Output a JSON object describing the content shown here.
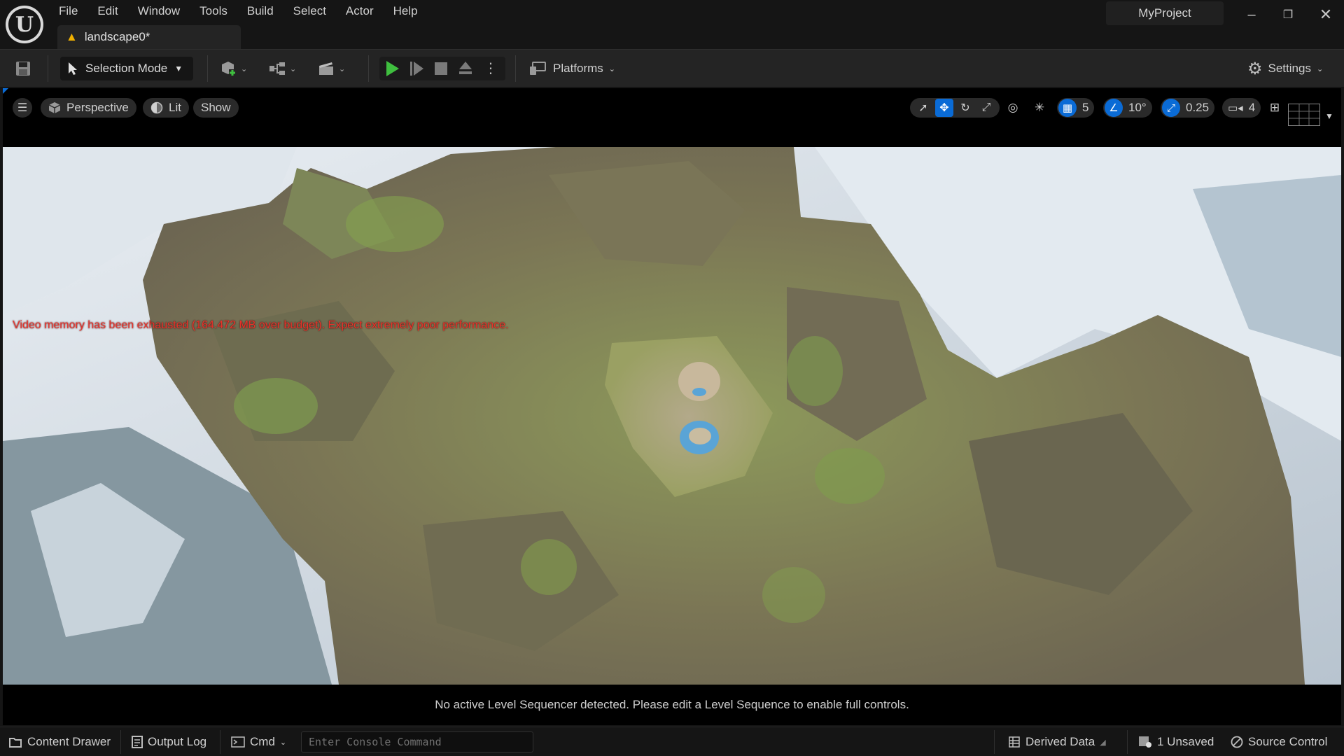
{
  "menu": {
    "items": [
      {
        "label": "File"
      },
      {
        "label": "Edit"
      },
      {
        "label": "Window"
      },
      {
        "label": "Tools"
      },
      {
        "label": "Build"
      },
      {
        "label": "Select"
      },
      {
        "label": "Actor"
      },
      {
        "label": "Help"
      }
    ]
  },
  "document_tab": {
    "label": "landscape0*"
  },
  "project": {
    "name": "MyProject"
  },
  "toolbar": {
    "mode_label": "Selection Mode",
    "platforms_label": "Platforms",
    "settings_label": "Settings"
  },
  "viewport": {
    "perspective_label": "Perspective",
    "lit_label": "Lit",
    "show_label": "Show",
    "grid_snap_value": "5",
    "rotation_snap_value": "10°",
    "scale_snap_value": "0.25",
    "camera_speed_value": "4",
    "warning_text": "Video memory has been exhausted (164.472 MB over budget). Expect extremely poor performance."
  },
  "sequencer": {
    "message": "No active Level Sequencer detected. Please edit a Level Sequence to enable full controls."
  },
  "statusbar": {
    "content_drawer_label": "Content Drawer",
    "output_log_label": "Output Log",
    "cmd_label": "Cmd",
    "console_placeholder": "Enter Console Command",
    "derived_data_label": "Derived Data",
    "unsaved_label": "1 Unsaved",
    "source_control_label": "Source Control"
  },
  "colors": {
    "accent": "#0a6bd6",
    "play": "#3fbf3f",
    "warning": "#e8322a",
    "tab_warning": "#f0b000"
  }
}
